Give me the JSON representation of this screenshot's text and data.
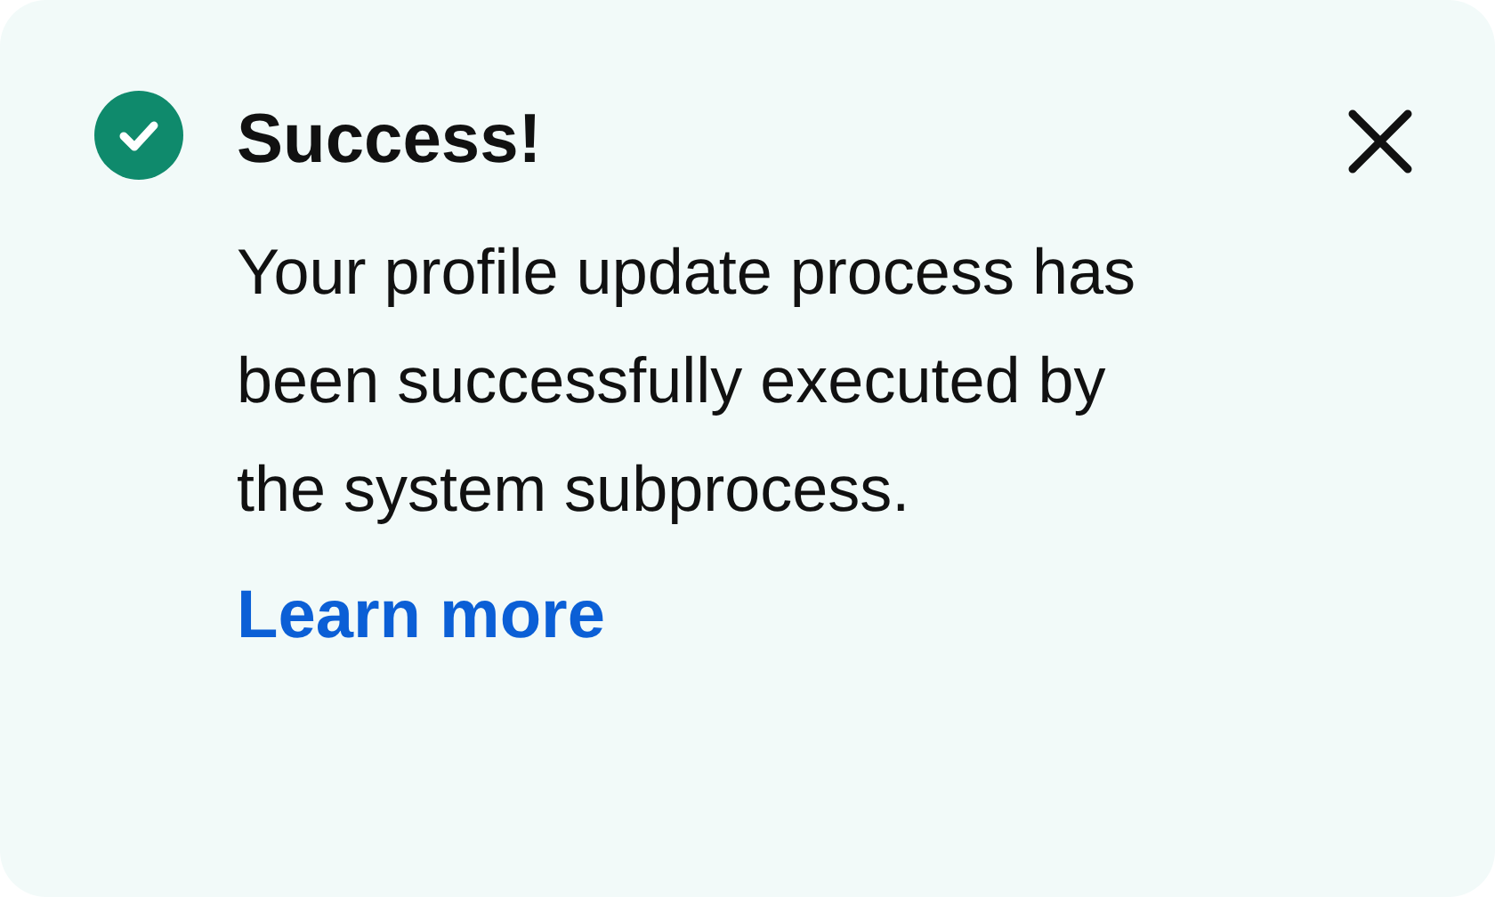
{
  "alert": {
    "kind": "success",
    "title": "Success!",
    "message": "Your profile update process has been successfully executed by the system subprocess.",
    "link": "Learn more",
    "dismissible": true
  }
}
